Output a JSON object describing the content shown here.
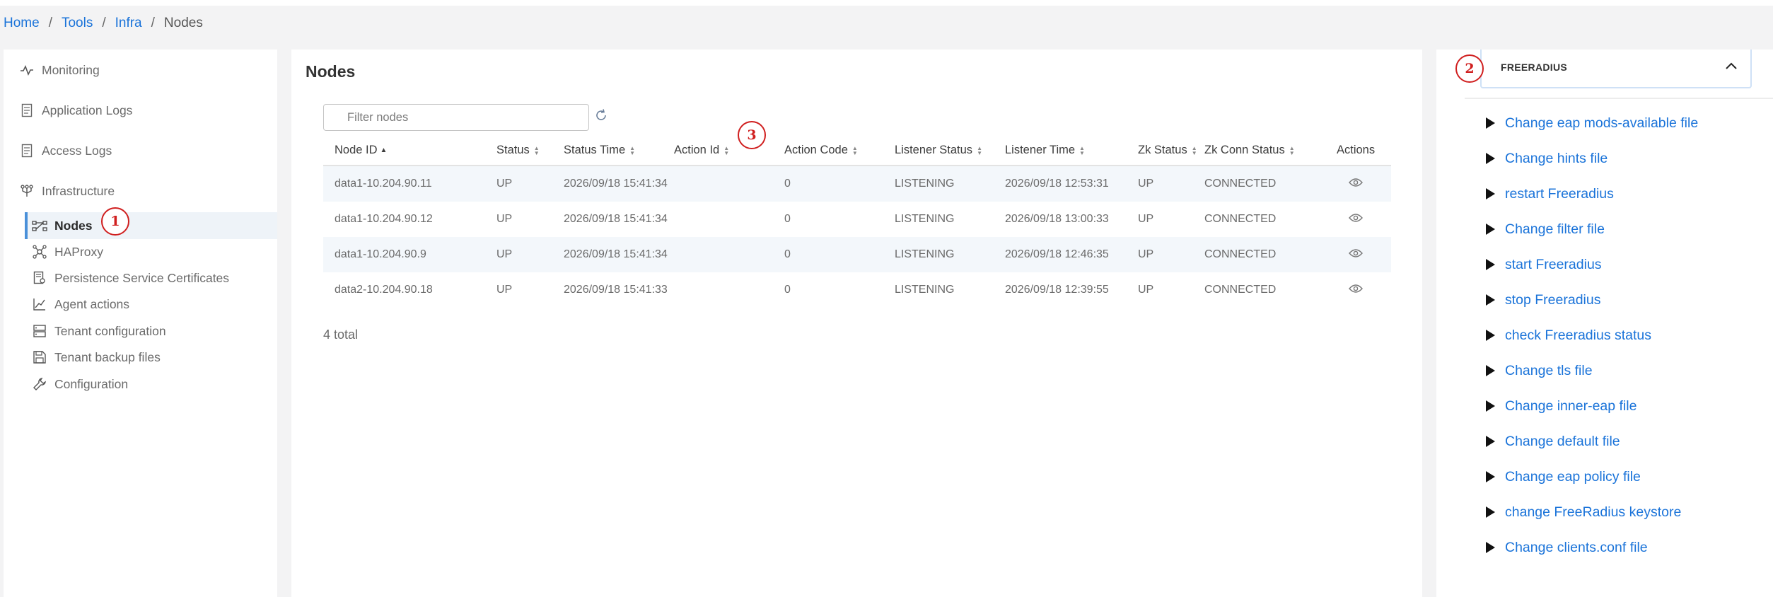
{
  "breadcrumb": {
    "home": "Home",
    "sep": "/",
    "tools": "Tools",
    "infra": "Infra",
    "current": "Nodes"
  },
  "sidebar": {
    "items": [
      {
        "label": "Monitoring",
        "icon": "activity-icon"
      },
      {
        "label": "Application Logs",
        "icon": "document-icon"
      },
      {
        "label": "Access Logs",
        "icon": "document-icon"
      },
      {
        "label": "Infrastructure",
        "icon": "fork-icon"
      }
    ],
    "sub_items": [
      {
        "label": "Nodes",
        "icon": "nodes-icon",
        "active": true
      },
      {
        "label": "HAProxy",
        "icon": "hub-icon"
      },
      {
        "label": "Persistence Service Certificates",
        "icon": "certificate-icon"
      },
      {
        "label": "Agent actions",
        "icon": "chart-line-icon"
      },
      {
        "label": "Tenant configuration",
        "icon": "server-icon"
      },
      {
        "label": "Tenant backup files",
        "icon": "save-icon"
      },
      {
        "label": "Configuration",
        "icon": "wrench-icon"
      }
    ]
  },
  "markers": {
    "m1": "1",
    "m2": "2",
    "m3": "3"
  },
  "main": {
    "title": "Nodes",
    "filter_placeholder": "Filter nodes",
    "columns": [
      "Node ID",
      "Status",
      "Status Time",
      "Action Id",
      "Action Code",
      "Listener Status",
      "Listener Time",
      "Zk Status",
      "Zk Conn Status",
      "Actions"
    ],
    "rows": [
      [
        "data1-10.204.90.11",
        "UP",
        "2026/09/18 15:41:34",
        "",
        "0",
        "LISTENING",
        "2026/09/18 12:53:31",
        "UP",
        "CONNECTED"
      ],
      [
        "data1-10.204.90.12",
        "UP",
        "2026/09/18 15:41:34",
        "",
        "0",
        "LISTENING",
        "2026/09/18 13:00:33",
        "UP",
        "CONNECTED"
      ],
      [
        "data1-10.204.90.9",
        "UP",
        "2026/09/18 15:41:34",
        "",
        "0",
        "LISTENING",
        "2026/09/18 12:46:35",
        "UP",
        "CONNECTED"
      ],
      [
        "data2-10.204.90.18",
        "UP",
        "2026/09/18 15:41:33",
        "",
        "0",
        "LISTENING",
        "2026/09/18 12:39:55",
        "UP",
        "CONNECTED"
      ]
    ],
    "total": "4 total"
  },
  "right_panel": {
    "title": "FREERADIUS",
    "actions": [
      "Change eap mods-available file",
      "Change hints file",
      "restart Freeradius",
      "Change filter file",
      "start Freeradius",
      "stop Freeradius",
      "check Freeradius status",
      "Change tls file",
      "Change inner-eap file",
      "Change default file",
      "Change eap policy file",
      "change FreeRadius keystore",
      "Change clients.conf file"
    ]
  },
  "colors": {
    "link": "#1a73d9",
    "marker": "#d01f1f",
    "active_bar": "#4a90d9"
  }
}
